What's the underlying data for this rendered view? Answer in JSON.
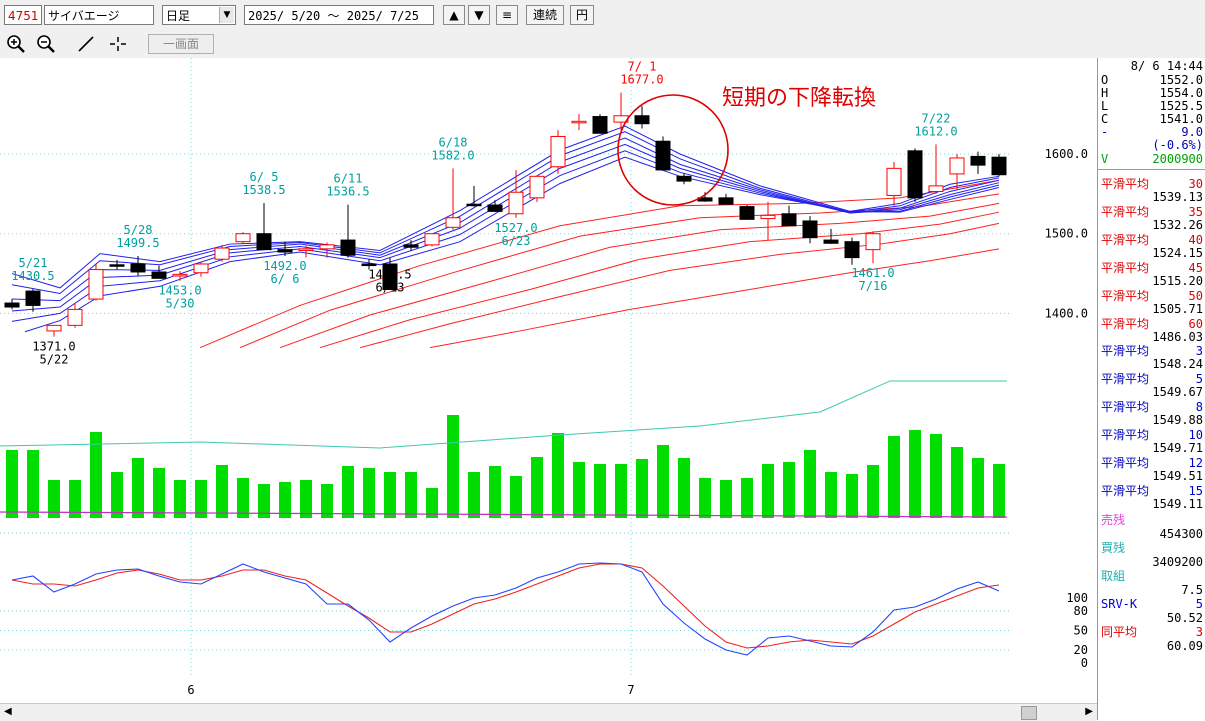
{
  "toolbar": {
    "code": "4751",
    "name": "サイバエージ",
    "period": "日足",
    "range_start": "2025/ 5/20",
    "range_sep": "～",
    "range_end": "2025/ 7/25",
    "up_arrow": "▲",
    "down_arrow": "▼",
    "menu_icon": "≡",
    "linked_label": "連続",
    "yen_label": "円",
    "one_screen_label": "一画面",
    "icons": [
      "zoom-in-icon",
      "zoom-out-icon",
      "trendline-icon",
      "crosshair-icon"
    ]
  },
  "sidebar": {
    "datetime": "8/ 6 14:44",
    "ohlc": [
      {
        "label": "O",
        "value": "1552.0"
      },
      {
        "label": "H",
        "value": "1554.0"
      },
      {
        "label": "L",
        "value": "1525.5"
      },
      {
        "label": "C",
        "value": "1541.0"
      }
    ],
    "change": {
      "label": "-",
      "value": "9.0"
    },
    "change_pct": "(-0.6%)",
    "volume": {
      "label": "V",
      "value": "2000900"
    },
    "ma_long": [
      {
        "label": "平滑平均",
        "period": "30",
        "value": "1539.13"
      },
      {
        "label": "平滑平均",
        "period": "35",
        "value": "1532.26"
      },
      {
        "label": "平滑平均",
        "period": "40",
        "value": "1524.15"
      },
      {
        "label": "平滑平均",
        "period": "45",
        "value": "1515.20"
      },
      {
        "label": "平滑平均",
        "period": "50",
        "value": "1505.71"
      },
      {
        "label": "平滑平均",
        "period": "60",
        "value": "1486.03"
      }
    ],
    "ma_short": [
      {
        "label": "平滑平均",
        "period": "3",
        "value": "1548.24"
      },
      {
        "label": "平滑平均",
        "period": "5",
        "value": "1549.67"
      },
      {
        "label": "平滑平均",
        "period": "8",
        "value": "1549.88"
      },
      {
        "label": "平滑平均",
        "period": "10",
        "value": "1549.71"
      },
      {
        "label": "平滑平均",
        "period": "12",
        "value": "1549.51"
      },
      {
        "label": "平滑平均",
        "period": "15",
        "value": "1549.11"
      }
    ],
    "margin": [
      {
        "label": "売残",
        "value": "454300"
      },
      {
        "label": "買残",
        "value": "3409200"
      },
      {
        "label": "取組",
        "value": "7.5"
      }
    ],
    "srv_k": {
      "label": "SRV-K",
      "period": "5",
      "value": "50.52"
    },
    "srv_avg": {
      "label": "同平均",
      "period": "3",
      "value": "60.09"
    }
  },
  "price_axis": [
    "1600.0",
    "1500.0",
    "1400.0"
  ],
  "stoch_axis": [
    "100",
    "80",
    "50",
    "20",
    "0"
  ],
  "month_labels": [
    "6",
    "7"
  ],
  "annotation": "短期の下降転換",
  "price_labels": [
    {
      "date": "5/21",
      "value": "1430.5",
      "kind": "high"
    },
    {
      "date": "5/22",
      "value": "1371.0",
      "kind": "low"
    },
    {
      "date": "5/28",
      "value": "1499.5",
      "kind": "high"
    },
    {
      "date": "5/30",
      "value": "1453.0",
      "kind": "low"
    },
    {
      "date": "6/ 5",
      "value": "1538.5",
      "kind": "high"
    },
    {
      "date": "6/ 6",
      "value": "1492.0",
      "kind": "low"
    },
    {
      "date": "6/11",
      "value": "1536.5",
      "kind": "high"
    },
    {
      "date": "6/13",
      "value": "1461.5",
      "kind": "low"
    },
    {
      "date": "6/18",
      "value": "1582.0",
      "kind": "high"
    },
    {
      "date": "6/23",
      "value": "1527.0",
      "kind": "low"
    },
    {
      "date": "7/ 1",
      "value": "1677.0",
      "kind": "high"
    },
    {
      "date": "7/16",
      "value": "1461.0",
      "kind": "low"
    },
    {
      "date": "7/22",
      "value": "1612.0",
      "kind": "high"
    }
  ],
  "colors": {
    "up": "#ff0000",
    "down": "#000000",
    "volume": "#00dd00",
    "ma_long": "#ff2020",
    "ma_short": "#2020ee",
    "volume_ma": "#40c8b0",
    "stoch_k": "#2244ff",
    "stoch_d": "#ee2222",
    "label_high": "#00a0a0",
    "label_low": "#000000"
  }
}
